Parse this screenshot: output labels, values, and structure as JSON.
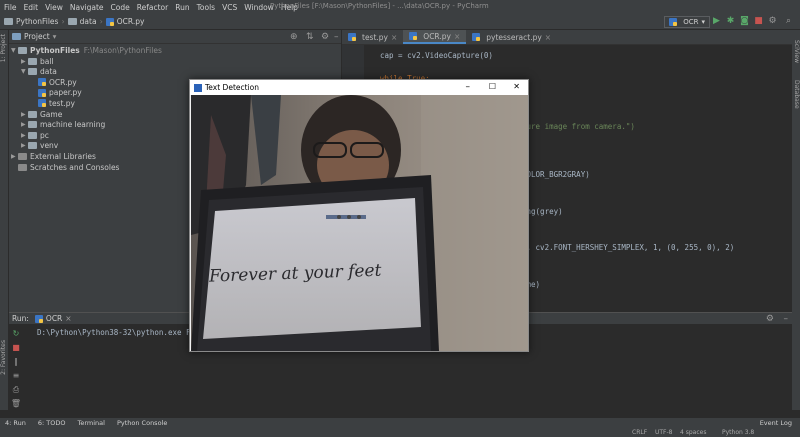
{
  "menu": {
    "items": [
      "File",
      "Edit",
      "View",
      "Navigate",
      "Code",
      "Refactor",
      "Run",
      "Tools",
      "VCS",
      "Window",
      "Help"
    ],
    "title": "PythonFiles [F:\\Mason\\PythonFiles] - ...\\data\\OCR.py - PyCharm"
  },
  "nav": {
    "crumbs": [
      "PythonFiles",
      "data",
      "OCR.py"
    ],
    "run_config": "OCR"
  },
  "project": {
    "header": "Project",
    "root": "PythonFiles",
    "root_path": "F:\\Mason\\PythonFiles",
    "items": [
      {
        "label": "ball",
        "type": "folder",
        "level": 1,
        "arrow": "▶"
      },
      {
        "label": "data",
        "type": "folder",
        "level": 1,
        "arrow": "▼"
      },
      {
        "label": "OCR.py",
        "type": "py",
        "level": 2,
        "arrow": ""
      },
      {
        "label": "paper.py",
        "type": "py",
        "level": 2,
        "arrow": ""
      },
      {
        "label": "test.py",
        "type": "py",
        "level": 2,
        "arrow": ""
      },
      {
        "label": "Game",
        "type": "folder",
        "level": 1,
        "arrow": "▶"
      },
      {
        "label": "machine learning",
        "type": "folder",
        "level": 1,
        "arrow": "▶"
      },
      {
        "label": "pc",
        "type": "folder",
        "level": 1,
        "arrow": "▶"
      },
      {
        "label": "venv",
        "type": "folder",
        "level": 1,
        "arrow": "▶"
      },
      {
        "label": "External Libraries",
        "type": "lib",
        "level": 0,
        "arrow": "▶"
      },
      {
        "label": "Scratches and Consoles",
        "type": "lib",
        "level": 0,
        "arrow": ""
      }
    ]
  },
  "editor": {
    "tabs": [
      "test.py",
      "OCR.py",
      "pytesseract.py"
    ],
    "active_tab": "OCR.py",
    "lines": [
      {
        "text": "cap = cv2.VideoCapture(0)",
        "color": "#a9b7c6"
      },
      {
        "text": "while True:",
        "color": "#cc7832"
      },
      {
        "text": "ture image from camera.\")",
        "color": "#6a8759"
      },
      {
        "text": "COLOR_BGR2GRAY)",
        "color": "#a9b7c6"
      },
      {
        "text": "ing(grey)",
        "color": "#a9b7c6"
      },
      {
        "text": "), cv2.FONT_HERSHEY_SIMPLEX, 1, (0, 255, 0), 2)",
        "color": "#a9b7c6"
      },
      {
        "text": "ame)",
        "color": "#a9b7c6"
      }
    ]
  },
  "run": {
    "label": "Run:",
    "tab": "OCR",
    "command": "D:\\Python\\Python38-32\\python.exe F:/..."
  },
  "bottom_tabs": [
    "4: Run",
    "6: TODO",
    "Terminal",
    "Python Console"
  ],
  "event_log": "Event Log",
  "status": {
    "crlf": "CRLF",
    "encoding": "UTF-8",
    "indent": "4 spaces",
    "interpreter": "Python 3.8"
  },
  "window": {
    "title": "Text Detection",
    "buttons": [
      "–",
      "☐",
      "✕"
    ],
    "detected_text": "Forever at your feet"
  },
  "side_labels": {
    "left": [
      "1: Project",
      "2: Favorites",
      "Structure"
    ],
    "right": [
      "SciView",
      "Database"
    ]
  }
}
